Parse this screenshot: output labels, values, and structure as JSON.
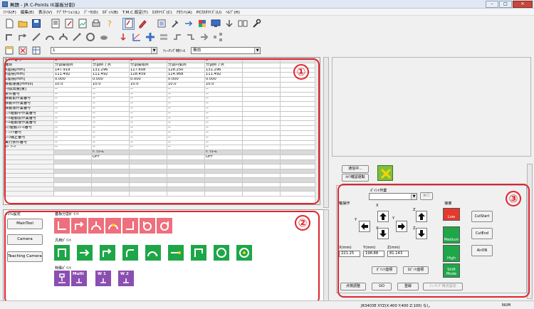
{
  "window": {
    "title": "無題 - JR C-Points II(基板分割)",
    "minimize": "–",
    "maximize": "□",
    "close": "✕"
  },
  "menu": [
    "ﾌｧｲﾙ(F)",
    "編集(E)",
    "表示(V)",
    "ｱﾌﾟﾘｹｰｼｮﾝ(L)",
    "ﾃﾞｰﾀ(D)",
    "ﾛﾎﾞｯﾄ(B)",
    "T.M.C.設定(T)",
    "ｶｽﾀﾏｲｽﾞ(C)",
    "ｱｶｳﾝﾄ(A)",
    "PCｶｽﾀﾏｲｽﾞ(U)",
    "ﾍﾙﾌﾟ(H)"
  ],
  "toolbar": {
    "program_combo": "1",
    "teaching_tool_label": "ﾃｨｰﾁﾝｸﾞ時ﾂｰﾙ",
    "teaching_tool_value": "無効"
  },
  "sheet": {
    "corner": "ﾎﾟｲﾝﾄ番号",
    "col_numbers": [
      "1",
      "2",
      "3",
      "4",
      "5"
    ],
    "rows": [
      {
        "label": "種別",
        "cells": [
          "分割開始点",
          "分割終了点",
          "分割開始点",
          "分割円弧点",
          "分割終了点"
        ]
      },
      {
        "label": "X座標[mm]",
        "cells": [
          "147.919",
          "131.296",
          "117.608",
          "128.250",
          "131.296"
        ]
      },
      {
        "label": "Y座標[mm]",
        "cells": [
          "111.492",
          "111.492",
          "118.459",
          "114.968",
          "111.492"
        ]
      },
      {
        "label": "Z座標[mm]",
        "cells": [
          "0.000",
          "0.000",
          "0.000",
          "0.000",
          "0.000"
        ]
      },
      {
        "label": "移動速度[mm/s]",
        "cells": [
          "10.0",
          "10.0",
          "10.0",
          "10.0",
          "10.0"
        ]
      },
      {
        "label": "円弧角度[度]",
        "cells": [
          "--",
          "--",
          "--",
          "--",
          "--"
        ]
      },
      {
        "label": "条件番号",
        "cells": [
          "--",
          "--",
          "--",
          "--",
          "--"
        ]
      },
      {
        "label": "移動前作業番号",
        "cells": [
          "--",
          "--",
          "--",
          "--",
          "--"
        ]
      },
      {
        "label": "移動中作業番号",
        "cells": [
          "--",
          "--",
          "--",
          "--",
          "--"
        ]
      },
      {
        "label": "移動後作業番号",
        "cells": [
          "--",
          "--",
          "--",
          "--",
          "--"
        ]
      },
      {
        "label": "ｼﾌﾄ駆動中作業番号",
        "cells": [
          "--",
          "--",
          "--",
          "--",
          "--"
        ]
      },
      {
        "label": "ﾂｰﾙ駆動前作業番号",
        "cells": [
          "--",
          "--",
          "--",
          "--",
          "--"
        ]
      },
      {
        "label": "ﾂｰﾙ駆動後作業番号",
        "cells": [
          "--",
          "--",
          "--",
          "--",
          "--"
        ]
      },
      {
        "label": "ｴｱ/駆動ｽｸｰﾙ番号",
        "cells": [
          "--",
          "--",
          "--",
          "--",
          "--"
        ]
      },
      {
        "label": "ﾊﾟﾚｯﾄ番号",
        "cells": [
          "--",
          "--",
          "--",
          "--",
          "--"
        ]
      },
      {
        "label": "ﾜｰｸ補正番号",
        "cells": [
          "--",
          "--",
          "--",
          "--",
          "--"
        ]
      },
      {
        "label": "実行条件番号",
        "cells": [
          "--",
          "--",
          "--",
          "--",
          "--"
        ]
      },
      {
        "label": "ﾀｸﾞﾁｰﾄﾞ",
        "cells": [
          "--",
          "--",
          "--",
          "--",
          "--"
        ]
      }
    ],
    "volume_row": [
      "",
      "ﾊﾞﾘｭｰﾑ",
      "",
      "",
      "ﾊﾞﾘｭｰﾑ"
    ],
    "off_row": [
      "",
      "OFF",
      "",
      "",
      "OFF"
    ]
  },
  "callouts": [
    "①",
    "②",
    "③"
  ],
  "panel2": {
    "title": "ｼｽﾃﾑ設定",
    "buttons": [
      "MainTool",
      "Camera",
      "Teaching Camera"
    ],
    "group1_label": "基板分割ﾎﾟｲﾝﾄ",
    "group2_label": "汎用ﾎﾟｲﾝﾄ",
    "group3_label": "特殊ﾎﾟｲﾝﾄ",
    "special_labels": [
      "",
      "Multi",
      "W 1",
      "W 2"
    ]
  },
  "right_top": {
    "comm_button": "通信中...",
    "camera_button": "ｶﾒﾗ確認運転"
  },
  "jog": {
    "point_work_label": "ﾎﾟｲﾝﾄ作業",
    "exec_button": "実行",
    "axis_label": "軸操作",
    "speed_label": "速度",
    "x_label": "X(mm)",
    "y_label": "Y(mm)",
    "z_label": "Z(mm)",
    "x_value": "221.25",
    "y_value": "198.88",
    "z_value": "81.143",
    "axis_letters": [
      "Y",
      "X",
      "X",
      "Y",
      "Z",
      "Z"
    ],
    "point_register": "ﾎﾟｲﾝﾄ座標",
    "robot_coord": "ﾛﾎﾞｯﾄ座標",
    "speeds": [
      "Low",
      "Medium",
      "High",
      "Shift Mode"
    ],
    "side_buttons": [
      "CutStart",
      "CutEnd",
      "AirON"
    ],
    "bottom_buttons": [
      "点検調整",
      "GO",
      "登録",
      "ﾃｨｰﾁﾝｸﾞ時点設定"
    ]
  },
  "status": {
    "robot": "JR3403E XYZ(X:400 Y:400 Z:100) なし",
    "num": "NUM"
  }
}
